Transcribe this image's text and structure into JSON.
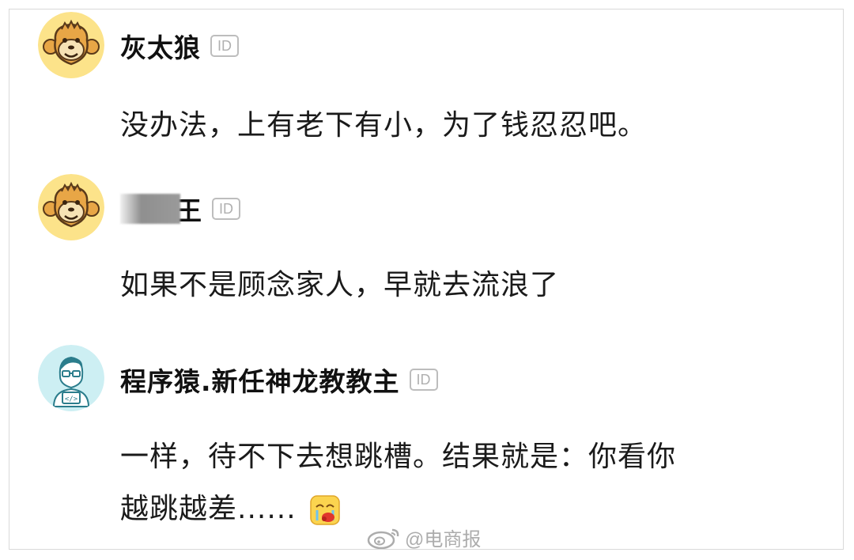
{
  "comments": [
    {
      "name": "灰太狼",
      "id_badge": "ID",
      "avatar": "monkey-avatar-icon",
      "text": "没办法，上有老下有小，为了钱忍忍吧。"
    },
    {
      "name_visible_suffix": "王",
      "name_blurred": true,
      "id_badge": "ID",
      "avatar": "monkey-avatar-icon",
      "text": "如果不是顾念家人，早就去流浪了"
    },
    {
      "name": "程序猿.新任神龙教教主",
      "id_badge": "ID",
      "avatar": "programmer-avatar-icon",
      "text_line1": "一样，待不下去想跳槽。结果就是：你看你",
      "text_line2": "越跳越差......",
      "emoji": "crying-emoji-icon"
    }
  ],
  "watermark": {
    "logo": "weibo-logo-icon",
    "text": "@电商报"
  },
  "colors": {
    "monkey_bg": "#fce38a",
    "programmer_bg": "#cdeff3",
    "name_text": "#111111",
    "body_text": "#1a1a1a",
    "badge_border": "#bdbdbd"
  }
}
